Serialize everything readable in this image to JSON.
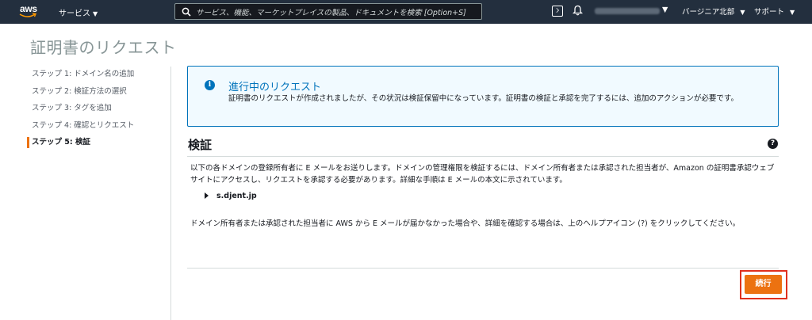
{
  "topnav": {
    "logo_text": "aws",
    "services_label": "サービス",
    "search_placeholder": "サービス、機能、マーケットプレイスの製品、ドキュメントを検索  [Option+S]",
    "region_label": "バージニア北部",
    "support_label": "サポート"
  },
  "page": {
    "title": "証明書のリクエスト"
  },
  "steps": [
    {
      "label": "ステップ 1: ドメイン名の追加"
    },
    {
      "label": "ステップ 2: 検証方法の選択"
    },
    {
      "label": "ステップ 3: タグを追加"
    },
    {
      "label": "ステップ 4: 確認とリクエスト"
    },
    {
      "label": "ステップ 5: 検証"
    }
  ],
  "alert": {
    "icon": "info-icon",
    "title": "進行中のリクエスト",
    "body": "証明書のリクエストが作成されましたが、その状況は検証保留中になっています。証明書の検証と承認を完了するには、追加のアクションが必要です。"
  },
  "verification": {
    "title": "検証",
    "description": "以下の各ドメインの登録所有者に E メールをお送りします。ドメインの管理権限を検証するには、ドメイン所有者または承認された担当者が、Amazon の証明書承認ウェブサイトにアクセスし、リクエストを承認する必要があります。詳細な手順は E メールの本文に示されています。",
    "domain": "s.djent.jp",
    "note": "ドメイン所有者または承認された担当者に AWS から E メールが届かなかった場合や、詳細を確認する場合は、上のヘルプアイコン (?) をクリックしてください。"
  },
  "actions": {
    "continue_label": "続行"
  },
  "colors": {
    "nav_bg": "#232f3e",
    "accent": "#ec7211",
    "info_blue": "#0073bb",
    "highlight_red": "#e0301e"
  }
}
